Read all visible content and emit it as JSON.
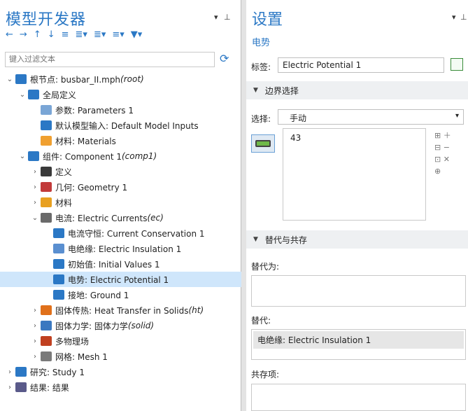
{
  "left": {
    "title": "模型开发器",
    "filter_placeholder": "键入过滤文本",
    "tree": [
      {
        "label": "根节点: busbar_II.mph ",
        "tag": "(root)",
        "arrow": "v",
        "icon": "root-node-icon",
        "color": "#2b78c5",
        "indent": 0
      },
      {
        "label": "全局定义",
        "arrow": "v",
        "icon": "globe-icon",
        "color": "#2b78c5",
        "indent": 1
      },
      {
        "label": "参数: Parameters 1",
        "arrow": "",
        "icon": "parameters-icon",
        "color": "#7aa6d6",
        "indent": 2
      },
      {
        "label": "默认模型输入: Default Model Inputs",
        "arrow": "",
        "icon": "model-inputs-icon",
        "color": "#2b78c5",
        "indent": 2
      },
      {
        "label": "材料: Materials",
        "arrow": "",
        "icon": "materials-icon",
        "color": "#f0a030",
        "indent": 2
      },
      {
        "label": "组件: Component 1 ",
        "tag": "(comp1)",
        "arrow": "v",
        "icon": "component-icon",
        "color": "#2b78c5",
        "indent": 1
      },
      {
        "label": "定义",
        "arrow": ">",
        "icon": "definitions-icon",
        "color": "#3a3a3a",
        "indent": 2
      },
      {
        "label": "几何: Geometry 1",
        "arrow": ">",
        "icon": "geometry-icon",
        "color": "#c23a3a",
        "indent": 2
      },
      {
        "label": "材料",
        "arrow": ">",
        "icon": "materials-grid-icon",
        "color": "#e8a020",
        "indent": 2
      },
      {
        "label": "电流: Electric Currents ",
        "tag": "(ec)",
        "arrow": "v",
        "icon": "electric-currents-icon",
        "color": "#6a6a6a",
        "indent": 2
      },
      {
        "label": "电流守恒: Current Conservation 1",
        "arrow": "",
        "icon": "current-conservation-icon",
        "color": "#2b78c5",
        "indent": 3
      },
      {
        "label": "电绝缘: Electric Insulation 1",
        "arrow": "",
        "icon": "electric-insulation-icon",
        "color": "#5a8fd0",
        "indent": 3
      },
      {
        "label": "初始值: Initial Values 1",
        "arrow": "",
        "icon": "initial-values-icon",
        "color": "#2b78c5",
        "indent": 3
      },
      {
        "label": "电势: Electric Potential 1",
        "arrow": "",
        "icon": "electric-potential-icon",
        "color": "#2b78c5",
        "indent": 3,
        "selected": true
      },
      {
        "label": "接地: Ground 1",
        "arrow": "",
        "icon": "ground-icon",
        "color": "#2b78c5",
        "indent": 3
      },
      {
        "label": "固体传热: Heat Transfer in Solids ",
        "tag": "(ht)",
        "arrow": ">",
        "icon": "heat-transfer-icon",
        "color": "#e0701a",
        "indent": 2
      },
      {
        "label": "固体力学: 固体力学 ",
        "tag": "(solid)",
        "arrow": ">",
        "icon": "solid-mechanics-icon",
        "color": "#3a78c0",
        "indent": 2
      },
      {
        "label": "多物理场",
        "arrow": ">",
        "icon": "multiphysics-icon",
        "color": "#c04020",
        "indent": 2
      },
      {
        "label": "网格: Mesh 1",
        "arrow": ">",
        "icon": "mesh-icon",
        "color": "#7a7a7a",
        "indent": 2
      },
      {
        "label": "研究: Study 1",
        "arrow": ">",
        "icon": "study-icon",
        "color": "#2b78c5",
        "indent": 0
      },
      {
        "label": "结果: 结果",
        "arrow": ">",
        "icon": "results-icon",
        "color": "#5a5a8a",
        "indent": 0
      }
    ]
  },
  "right": {
    "title": "设置",
    "subtitle": "电势",
    "label_caption": "标签:",
    "label_value": "Electric Potential 1",
    "section_boundary": "边界选择",
    "selection_caption": "选择:",
    "selection_value": "手动",
    "selection_item": "43",
    "section_override": "替代与共存",
    "overridden_by": "替代为:",
    "overrides": "替代:",
    "overrides_item": "电绝缘: Electric Insulation 1",
    "coexist": "共存项:"
  }
}
